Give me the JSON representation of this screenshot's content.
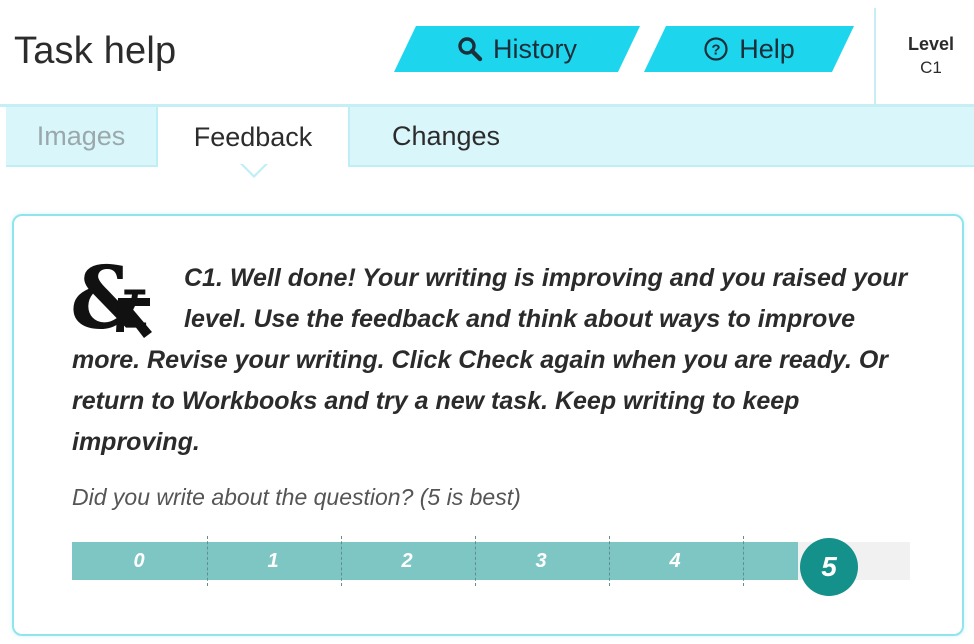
{
  "header": {
    "title": "Task help",
    "history_label": "History",
    "help_label": "Help",
    "level_label": "Level",
    "level_value": "C1"
  },
  "tabs": [
    {
      "label": "Images",
      "active": false
    },
    {
      "label": "Feedback",
      "active": true
    },
    {
      "label": "Changes",
      "active": false
    }
  ],
  "feedback": {
    "message": "C1. Well done! Your writing is improving and you raised your level. Use the feedback and think about ways to improve more. Revise your writing. Click Check again when you are ready. Or return to Workbooks and try a new task. Keep writing to keep improving.",
    "question": "Did you write about the question? (5 is best)",
    "scale": {
      "options": [
        "0",
        "1",
        "2",
        "3",
        "4",
        "5"
      ],
      "selected": "5",
      "selected_index": 5
    }
  },
  "colors": {
    "accent": "#1dd6ee",
    "tab_bar": "#d9f7fb",
    "scale_fill": "#7ec6c4",
    "score": "#15918c"
  },
  "icons": {
    "history": "search-icon",
    "help": "help-circle-icon",
    "logo": "ampersand-logo"
  }
}
